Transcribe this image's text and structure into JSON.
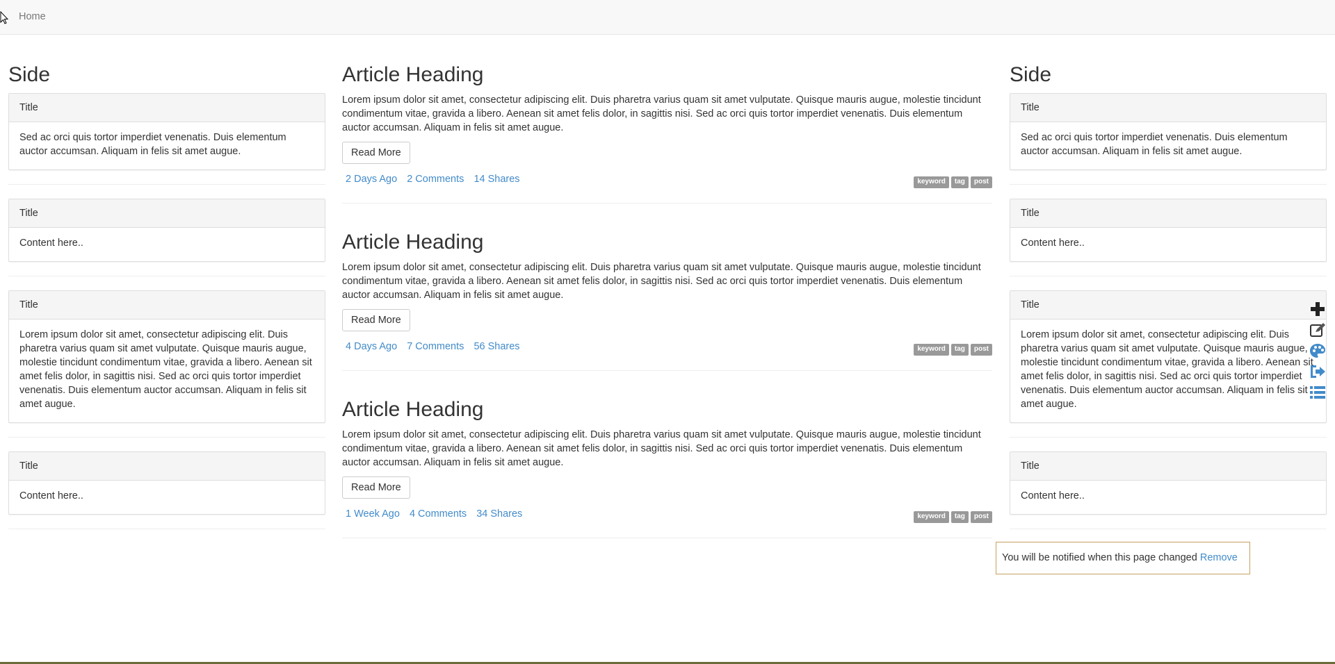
{
  "navbar": {
    "home_label": "Home"
  },
  "left_sidebar": {
    "heading": "Side",
    "panels": [
      {
        "title": "Title",
        "body": "Sed ac orci quis tortor imperdiet venenatis. Duis elementum auctor accumsan. Aliquam in felis sit amet augue."
      },
      {
        "title": "Title",
        "body": "Content here.."
      },
      {
        "title": "Title",
        "body": "Lorem ipsum dolor sit amet, consectetur adipiscing elit. Duis pharetra varius quam sit amet vulputate. Quisque mauris augue, molestie tincidunt condimentum vitae, gravida a libero. Aenean sit amet felis dolor, in sagittis nisi. Sed ac orci quis tortor imperdiet venenatis. Duis elementum auctor accumsan. Aliquam in felis sit amet augue."
      },
      {
        "title": "Title",
        "body": "Content here.."
      }
    ]
  },
  "right_sidebar": {
    "heading": "Side",
    "panels": [
      {
        "title": "Title",
        "body": "Sed ac orci quis tortor imperdiet venenatis. Duis elementum auctor accumsan. Aliquam in felis sit amet augue."
      },
      {
        "title": "Title",
        "body": "Content here.."
      },
      {
        "title": "Title",
        "body": "Lorem ipsum dolor sit amet, consectetur adipiscing elit. Duis pharetra varius quam sit amet vulputate. Quisque mauris augue, molestie tincidunt condimentum vitae, gravida a libero. Aenean sit amet felis dolor, in sagittis nisi. Sed ac orci quis tortor imperdiet venenatis. Duis elementum auctor accumsan. Aliquam in felis sit amet augue."
      },
      {
        "title": "Title",
        "body": "Content here.."
      }
    ]
  },
  "articles": [
    {
      "heading": "Article Heading",
      "body": "Lorem ipsum dolor sit amet, consectetur adipiscing elit. Duis pharetra varius quam sit amet vulputate. Quisque mauris augue, molestie tincidunt condimentum vitae, gravida a libero. Aenean sit amet felis dolor, in sagittis nisi. Sed ac orci quis tortor imperdiet venenatis. Duis elementum auctor accumsan. Aliquam in felis sit amet augue.",
      "read_more": "Read More",
      "date": "2 Days Ago",
      "comments": "2 Comments",
      "shares": "14 Shares",
      "tags": [
        "keyword",
        "tag",
        "post"
      ]
    },
    {
      "heading": "Article Heading",
      "body": "Lorem ipsum dolor sit amet, consectetur adipiscing elit. Duis pharetra varius quam sit amet vulputate. Quisque mauris augue, molestie tincidunt condimentum vitae, gravida a libero. Aenean sit amet felis dolor, in sagittis nisi. Sed ac orci quis tortor imperdiet venenatis. Duis elementum auctor accumsan. Aliquam in felis sit amet augue.",
      "read_more": "Read More",
      "date": "4 Days Ago",
      "comments": "7 Comments",
      "shares": "56 Shares",
      "tags": [
        "keyword",
        "tag",
        "post"
      ]
    },
    {
      "heading": "Article Heading",
      "body": "Lorem ipsum dolor sit amet, consectetur adipiscing elit. Duis pharetra varius quam sit amet vulputate. Quisque mauris augue, molestie tincidunt condimentum vitae, gravida a libero. Aenean sit amet felis dolor, in sagittis nisi. Sed ac orci quis tortor imperdiet venenatis. Duis elementum auctor accumsan. Aliquam in felis sit amet augue.",
      "read_more": "Read More",
      "date": "1 Week Ago",
      "comments": "4 Comments",
      "shares": "34 Shares",
      "tags": [
        "keyword",
        "tag",
        "post"
      ]
    }
  ],
  "toolbar": {
    "icons": [
      "plus-icon",
      "edit-icon",
      "palette-icon",
      "sign-out-icon",
      "list-icon"
    ],
    "accent": "#428bca"
  },
  "notification": {
    "message": "You will be notified when this page changed",
    "remove_label": "Remove"
  },
  "colors": {
    "link": "#428bca",
    "tag_bg": "#999999",
    "notify_border": "#c8a060"
  }
}
